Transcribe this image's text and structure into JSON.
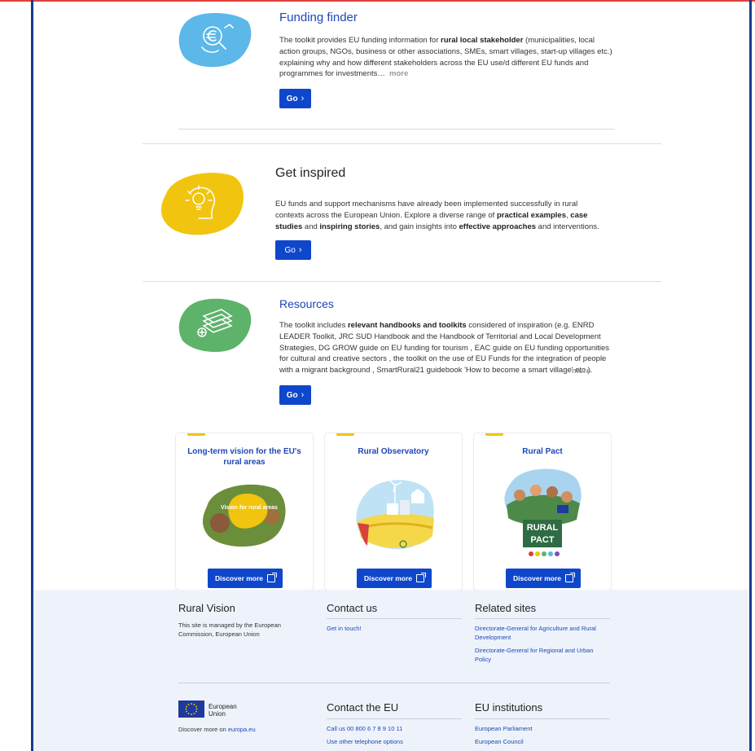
{
  "sections": [
    {
      "title": "Funding finder",
      "text_parts": [
        {
          "t": "The toolkit provides EU funding information for ",
          "b": false
        },
        {
          "t": "rural local stakeholder",
          "b": true
        },
        {
          "t": " (municipalities, local action groups, NGOs, business or other associations, SMEs, smart villages, start-up villages etc.) explaining why and how different stakeholders across the EU use/d different EU funds and programmes for investments…",
          "b": false
        }
      ],
      "more_label": "more",
      "button_label": "Go",
      "icon": "euro-search-icon",
      "color": "#5bb8e8"
    },
    {
      "title": "Get inspired",
      "text_parts": [
        {
          "t": "EU funds and support mechanisms have already been implemented successfully in rural contexts across the European Union. Explore a diverse range of ",
          "b": false
        },
        {
          "t": "practical examples",
          "b": true
        },
        {
          "t": ", ",
          "b": false
        },
        {
          "t": "case studies",
          "b": true
        },
        {
          "t": " and ",
          "b": false
        },
        {
          "t": "inspiring stories",
          "b": true
        },
        {
          "t": ", and gain insights into ",
          "b": false
        },
        {
          "t": "effective approaches",
          "b": true
        },
        {
          "t": " and interventions.",
          "b": false
        }
      ],
      "button_label": "Go",
      "icon": "lightbulb-head-icon",
      "color": "#f1c40f"
    },
    {
      "title": "Resources",
      "text_parts": [
        {
          "t": "The toolkit includes ",
          "b": false
        },
        {
          "t": "relevant handbooks and toolkits",
          "b": true
        },
        {
          "t": " considered of inspiration (e.g. ENRD LEADER Toolkit, JRC SUD Handbook and the Handbook of Territorial and Local Development Strategies, DG GROW guide on EU funding for tourism , EAC guide on EU funding opportunities for cultural and creative sectors , the toolkit on the use of EU Funds for the integration of people with a migrant background , SmartRural21 guidebook 'How to become a smart village'  etc.).",
          "b": false
        }
      ],
      "more_label": "more",
      "button_label": "Go",
      "icon": "books-icon",
      "color": "#5db36a"
    }
  ],
  "cards": [
    {
      "title": "Long-term vision for the EU's rural areas",
      "art_text": "Vision for rural areas",
      "button_label": "Discover more"
    },
    {
      "title": "Rural Observatory",
      "button_label": "Discover more"
    },
    {
      "title": "Rural Pact",
      "art_text_1": "RURAL",
      "art_text_2": "PACT",
      "button_label": "Discover more"
    }
  ],
  "footer": {
    "col1": {
      "title": "Rural Vision",
      "text": "This site is managed by the European Commission, European Union"
    },
    "col2": {
      "title": "Contact us",
      "link": "Get in touch!"
    },
    "col3": {
      "title": "Related sites",
      "links": [
        "Directorate-General for Agriculture and Rural Development",
        "Directorate-General for Regional and Urban Policy"
      ]
    },
    "eu": {
      "logo_line1": "European",
      "logo_line2": "Union",
      "discover_prefix": "Discover more on ",
      "discover_link": "europa.eu"
    },
    "contact_eu": {
      "title": "Contact the EU",
      "links": [
        "Call us 00 800 6 7 8 9 10 11",
        "Use other telephone options"
      ]
    },
    "institutions": {
      "title": "EU institutions",
      "links": [
        "European Parliament",
        "European Council"
      ]
    }
  },
  "colors": {
    "primary_blue": "#0e47cb",
    "title_blue": "#1d47b8",
    "footer_bg": "#eef3fb",
    "accent_yellow": "#f4c400"
  }
}
